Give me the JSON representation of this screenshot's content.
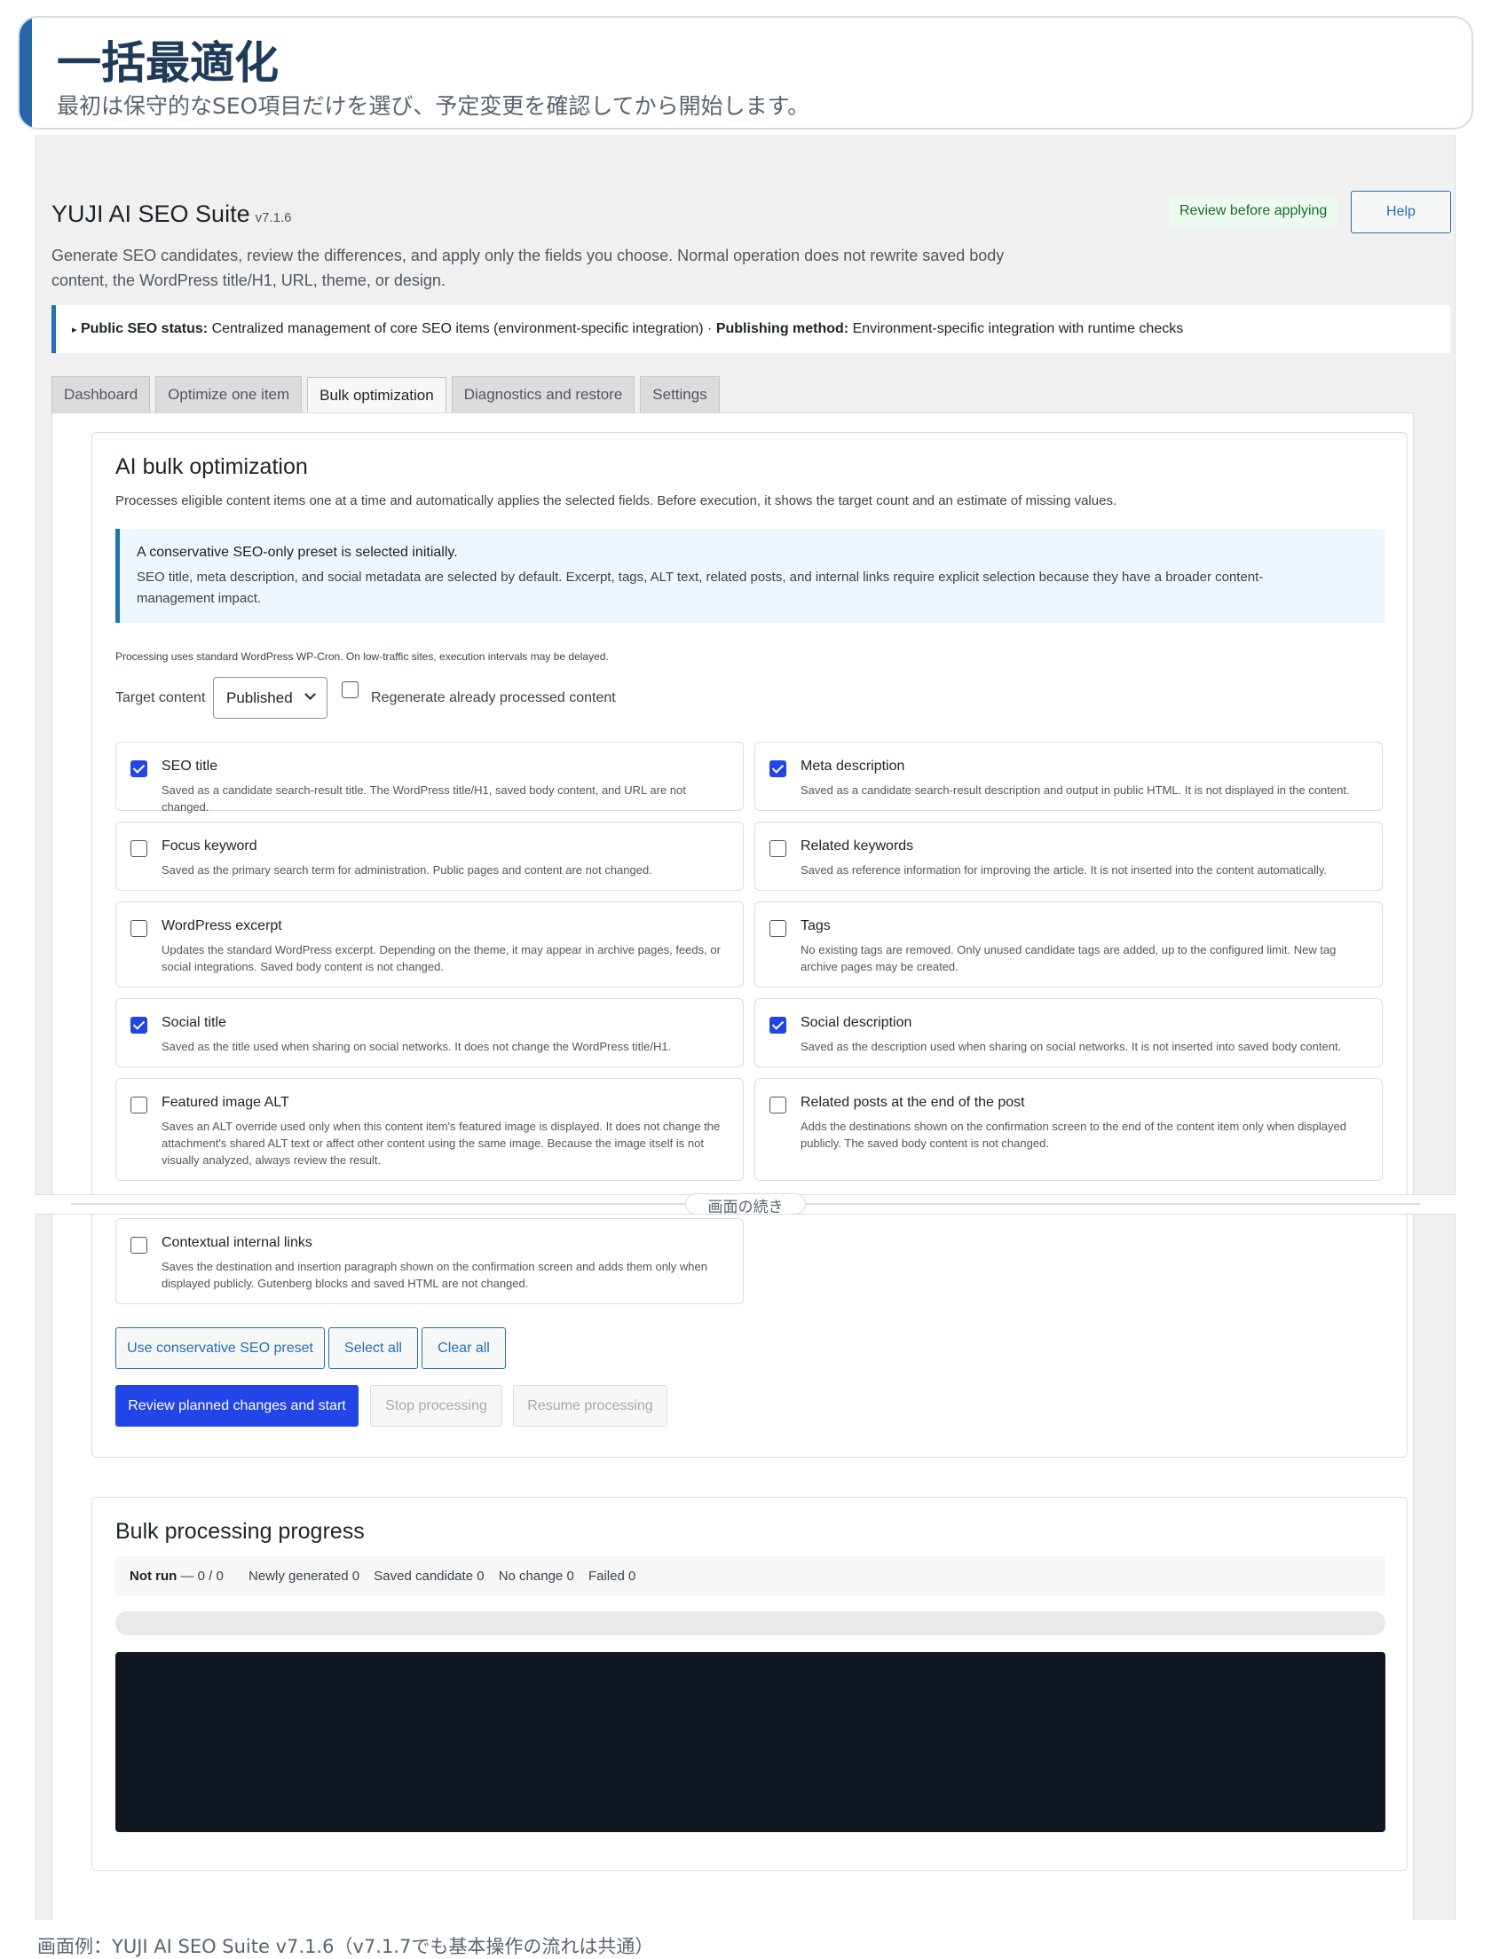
{
  "banner": {
    "title": "一括最適化",
    "subtitle": "最初は保守的なSEO項目だけを選び、予定変更を確認してから開始します。"
  },
  "app": {
    "name": "YUJI AI SEO Suite",
    "version": "v7.1.6",
    "badge": "Review before applying",
    "help": "Help",
    "description": "Generate SEO candidates, review the differences, and apply only the fields you choose. Normal operation does not rewrite saved body content, the WordPress title/H1, URL, theme, or design."
  },
  "notice": {
    "arrow": "▸",
    "status_label": "Public SEO status:",
    "status_value": "Centralized management of core SEO items (environment-specific integration) ·",
    "method_label": "Publishing method:",
    "method_value": "Environment-specific integration with runtime checks"
  },
  "tabs": [
    {
      "label": "Dashboard"
    },
    {
      "label": "Optimize one item"
    },
    {
      "label": "Bulk optimization"
    },
    {
      "label": "Diagnostics and restore"
    },
    {
      "label": "Settings"
    }
  ],
  "bulk": {
    "heading": "AI bulk optimization",
    "intro": "Processes eligible content items one at a time and automatically applies the selected fields. Before execution, it shows the target count and an estimate of missing values.",
    "info_title": "A conservative SEO-only preset is selected initially.",
    "info_body": "SEO title, meta description, and social metadata are selected by default. Excerpt, tags, ALT text, related posts, and internal links require explicit selection because they have a broader content-management impact.",
    "cron_note": "Processing uses standard WordPress WP-Cron. On low-traffic sites, execution intervals may be delayed.",
    "target_label": "Target content",
    "target_value": "Published",
    "regen_label": "Regenerate already processed content",
    "options": [
      {
        "label": "SEO title",
        "desc": "Saved as a candidate search-result title. The WordPress title/H1, saved body content, and URL are not changed.",
        "checked": true
      },
      {
        "label": "Meta description",
        "desc": "Saved as a candidate search-result description and output in public HTML. It is not displayed in the content.",
        "checked": true
      },
      {
        "label": "Focus keyword",
        "desc": "Saved as the primary search term for administration. Public pages and content are not changed.",
        "checked": false
      },
      {
        "label": "Related keywords",
        "desc": "Saved as reference information for improving the article. It is not inserted into the content automatically.",
        "checked": false
      },
      {
        "label": "WordPress excerpt",
        "desc": "Updates the standard WordPress excerpt. Depending on the theme, it may appear in archive pages, feeds, or social integrations. Saved body content is not changed.",
        "checked": false
      },
      {
        "label": "Tags",
        "desc": "No existing tags are removed. Only unused candidate tags are added, up to the configured limit. New tag archive pages may be created.",
        "checked": false
      },
      {
        "label": "Social title",
        "desc": "Saved as the title used when sharing on social networks. It does not change the WordPress title/H1.",
        "checked": true
      },
      {
        "label": "Social description",
        "desc": "Saved as the description used when sharing on social networks. It is not inserted into saved body content.",
        "checked": true
      },
      {
        "label": "Featured image ALT",
        "desc": "Saves an ALT override used only when this content item's featured image is displayed. It does not change the attachment's shared ALT text or affect other content using the same image. Because the image itself is not visually analyzed, always review the result.",
        "checked": false
      },
      {
        "label": "Related posts at the end of the post",
        "desc": "Adds the destinations shown on the confirmation screen to the end of the content item only when displayed publicly. The saved body content is not changed.",
        "checked": false
      },
      {
        "label": "Contextual internal links",
        "desc": "Saves the destination and insertion paragraph shown on the confirmation screen and adds them only when displayed publicly. Gutenberg blocks and saved HTML are not changed.",
        "checked": false
      }
    ],
    "buttons": {
      "preset": "Use conservative SEO preset",
      "select_all": "Select all",
      "clear_all": "Clear all",
      "start": "Review planned changes and start",
      "stop": "Stop processing",
      "resume": "Resume processing"
    }
  },
  "progress": {
    "heading": "Bulk processing progress",
    "status": "Not run",
    "count": "— 0 / 0",
    "newly": "Newly generated 0",
    "saved": "Saved candidate 0",
    "nochange": "No change 0",
    "failed": "Failed 0",
    "percent": 0
  },
  "divider_label": "画面の続き",
  "caption": "画面例：YUJI AI SEO Suite v7.1.6（v7.1.7でも基本操作の流れは共通）"
}
